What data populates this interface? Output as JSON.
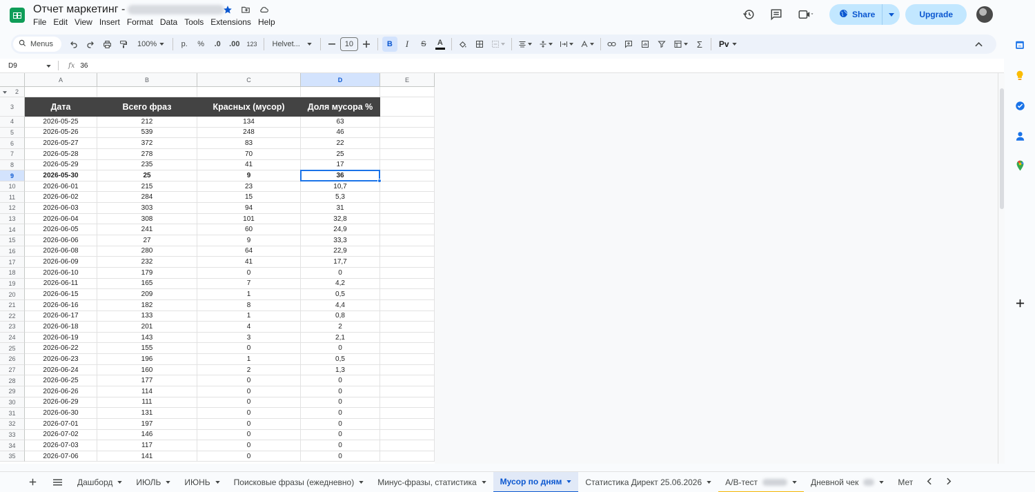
{
  "app": {
    "title": "Отчет маркетинг -",
    "menu": [
      "File",
      "Edit",
      "View",
      "Insert",
      "Format",
      "Data",
      "Tools",
      "Extensions",
      "Help"
    ],
    "share_label": "Share",
    "upgrade_label": "Upgrade"
  },
  "toolbar": {
    "menus_label": "Menus",
    "zoom": "100%",
    "currency": "р.",
    "percent": "%",
    "dec_less": ".0",
    "dec_more": ".00",
    "num_format": "123",
    "font": "Helvet...",
    "font_size": "10",
    "bold": "B",
    "italic": "I",
    "strike": "S",
    "text_color": "A",
    "sum": "Σ",
    "cyrillic": "Рv"
  },
  "formula_bar": {
    "cell_ref": "D9",
    "fx": "fx",
    "value": "36"
  },
  "grid": {
    "columns": [
      "A",
      "B",
      "C",
      "D",
      "E"
    ],
    "selected_column": "D",
    "selected_row": 9,
    "row_numbers": [
      2,
      3,
      4,
      5,
      6,
      7,
      8,
      9,
      10,
      11,
      12,
      13,
      14,
      15,
      16,
      17,
      18,
      19,
      20,
      21,
      22,
      23,
      24,
      25,
      26,
      27,
      28,
      29,
      30,
      31,
      32,
      33,
      34,
      35
    ],
    "header": [
      "Дата",
      "Всего фраз",
      "Красных (мусор)",
      "Доля мусора %"
    ],
    "rows": [
      [
        "2026-05-25",
        "212",
        "134",
        "63"
      ],
      [
        "2026-05-26",
        "539",
        "248",
        "46"
      ],
      [
        "2026-05-27",
        "372",
        "83",
        "22"
      ],
      [
        "2026-05-28",
        "278",
        "70",
        "25"
      ],
      [
        "2026-05-29",
        "235",
        "41",
        "17"
      ],
      [
        "2026-05-30",
        "25",
        "9",
        "36"
      ],
      [
        "2026-06-01",
        "215",
        "23",
        "10,7"
      ],
      [
        "2026-06-02",
        "284",
        "15",
        "5,3"
      ],
      [
        "2026-06-03",
        "303",
        "94",
        "31"
      ],
      [
        "2026-06-04",
        "308",
        "101",
        "32,8"
      ],
      [
        "2026-06-05",
        "241",
        "60",
        "24,9"
      ],
      [
        "2026-06-06",
        "27",
        "9",
        "33,3"
      ],
      [
        "2026-06-08",
        "280",
        "64",
        "22,9"
      ],
      [
        "2026-06-09",
        "232",
        "41",
        "17,7"
      ],
      [
        "2026-06-10",
        "179",
        "0",
        "0"
      ],
      [
        "2026-06-11",
        "165",
        "7",
        "4,2"
      ],
      [
        "2026-06-15",
        "209",
        "1",
        "0,5"
      ],
      [
        "2026-06-16",
        "182",
        "8",
        "4,4"
      ],
      [
        "2026-06-17",
        "133",
        "1",
        "0,8"
      ],
      [
        "2026-06-18",
        "201",
        "4",
        "2"
      ],
      [
        "2026-06-19",
        "143",
        "3",
        "2,1"
      ],
      [
        "2026-06-22",
        "155",
        "0",
        "0"
      ],
      [
        "2026-06-23",
        "196",
        "1",
        "0,5"
      ],
      [
        "2026-06-24",
        "160",
        "2",
        "1,3"
      ],
      [
        "2026-06-25",
        "177",
        "0",
        "0"
      ],
      [
        "2026-06-26",
        "114",
        "0",
        "0"
      ],
      [
        "2026-06-29",
        "111",
        "0",
        "0"
      ],
      [
        "2026-06-30",
        "131",
        "0",
        "0"
      ],
      [
        "2026-07-01",
        "197",
        "0",
        "0"
      ],
      [
        "2026-07-02",
        "146",
        "0",
        "0"
      ],
      [
        "2026-07-03",
        "117",
        "0",
        "0"
      ],
      [
        "2026-07-06",
        "141",
        "0",
        "0"
      ]
    ],
    "bold_row_index": 5
  },
  "sheet_tabs": [
    {
      "label": "Дашборд",
      "active": false
    },
    {
      "label": "ИЮЛЬ",
      "active": false
    },
    {
      "label": "ИЮНЬ",
      "active": false
    },
    {
      "label": "Поисковые фразы (ежедневно)",
      "active": false
    },
    {
      "label": "Минус-фразы, статистика",
      "active": false
    },
    {
      "label": "Мусор по дням",
      "active": true
    },
    {
      "label": "Статистика Директ 25.06.2026",
      "active": false
    },
    {
      "label": "A/B-тест",
      "active": false
    },
    {
      "label": "Дневной чек",
      "active": false
    },
    {
      "label": "Мет",
      "active": false
    }
  ],
  "colors": {
    "header_fill": "#434343",
    "selection": "#1a73e8",
    "accent": "#0b57d0",
    "share_bg": "#c2e7ff"
  }
}
